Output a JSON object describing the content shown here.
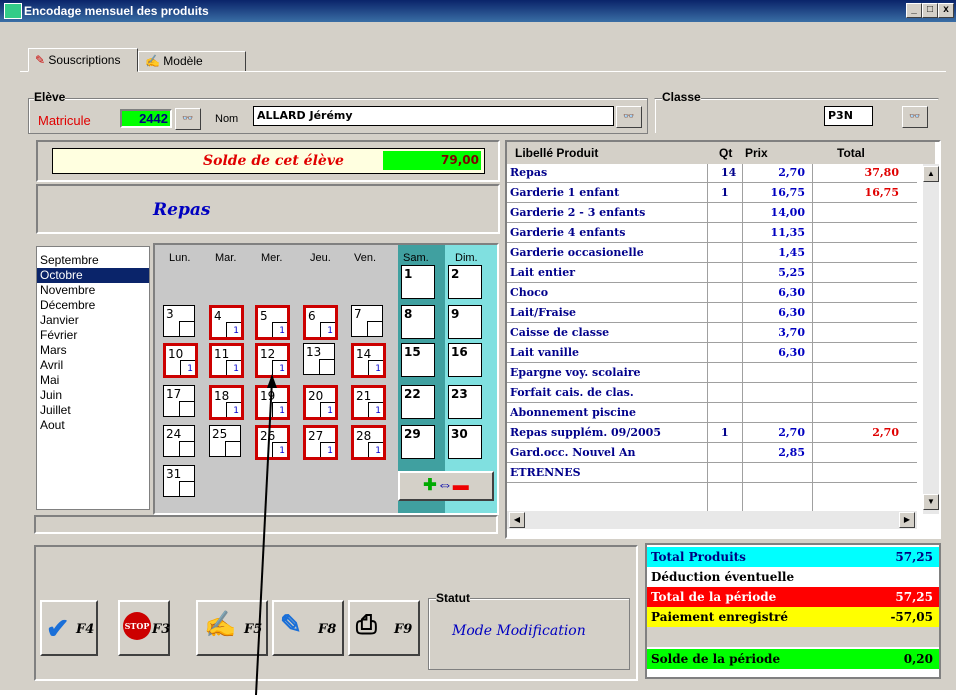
{
  "window": {
    "title": "Encodage mensuel des produits"
  },
  "tabs": [
    {
      "label": "Souscriptions"
    },
    {
      "label": "Modèle"
    }
  ],
  "eleve": {
    "group_label": "Elève",
    "matricule_label": "Matricule",
    "matricule_value": "2442",
    "nom_label": "Nom",
    "nom_value": "ALLARD Jérémy"
  },
  "classe": {
    "group_label": "Classe",
    "value": "P3N"
  },
  "solde": {
    "label": "Solde de cet élève",
    "value": "79,00"
  },
  "product_title": "Repas",
  "months": [
    "Septembre",
    "Octobre",
    "Novembre",
    "Décembre",
    "Janvier",
    "Février",
    "Mars",
    "Avril",
    "Mai",
    "Juin",
    "Juillet",
    "Aout"
  ],
  "selected_month": "Octobre",
  "weekdays": [
    "Lun.",
    "Mar.",
    "Mer.",
    "Jeu.",
    "Ven.",
    "Sam.",
    "Dim."
  ],
  "calendar": [
    {
      "day": "1",
      "q": ""
    },
    {
      "day": "2",
      "q": ""
    },
    {
      "day": "3",
      "q": ""
    },
    {
      "day": "4",
      "q": "1"
    },
    {
      "day": "5",
      "q": "1"
    },
    {
      "day": "6",
      "q": "1"
    },
    {
      "day": "7",
      "q": ""
    },
    {
      "day": "8",
      "q": ""
    },
    {
      "day": "9",
      "q": ""
    },
    {
      "day": "10",
      "q": "1"
    },
    {
      "day": "11",
      "q": "1"
    },
    {
      "day": "12",
      "q": "1"
    },
    {
      "day": "13",
      "q": ""
    },
    {
      "day": "14",
      "q": "1"
    },
    {
      "day": "15",
      "q": ""
    },
    {
      "day": "16",
      "q": ""
    },
    {
      "day": "17",
      "q": ""
    },
    {
      "day": "18",
      "q": "1"
    },
    {
      "day": "19",
      "q": "1"
    },
    {
      "day": "20",
      "q": "1"
    },
    {
      "day": "21",
      "q": "1"
    },
    {
      "day": "22",
      "q": ""
    },
    {
      "day": "23",
      "q": ""
    },
    {
      "day": "24",
      "q": ""
    },
    {
      "day": "25",
      "q": ""
    },
    {
      "day": "26",
      "q": "1"
    },
    {
      "day": "27",
      "q": "1"
    },
    {
      "day": "28",
      "q": "1"
    },
    {
      "day": "29",
      "q": ""
    },
    {
      "day": "30",
      "q": ""
    },
    {
      "day": "31",
      "q": ""
    }
  ],
  "grid": {
    "headers": {
      "libelle": "Libellé Produit",
      "qt": "Qt",
      "prix": "Prix",
      "total": "Total"
    },
    "rows": [
      {
        "libelle": "Repas",
        "qt": "14",
        "prix": "2,70",
        "total": "37,80"
      },
      {
        "libelle": "Garderie 1 enfant",
        "qt": "1",
        "prix": "16,75",
        "total": "16,75"
      },
      {
        "libelle": "Garderie 2 - 3 enfants",
        "qt": "",
        "prix": "14,00",
        "total": ""
      },
      {
        "libelle": "Garderie 4 enfants",
        "qt": "",
        "prix": "11,35",
        "total": ""
      },
      {
        "libelle": "Garderie occasionelle",
        "qt": "",
        "prix": "1,45",
        "total": ""
      },
      {
        "libelle": "Lait entier",
        "qt": "",
        "prix": "5,25",
        "total": ""
      },
      {
        "libelle": "Choco",
        "qt": "",
        "prix": "6,30",
        "total": ""
      },
      {
        "libelle": "Lait/Fraise",
        "qt": "",
        "prix": "6,30",
        "total": ""
      },
      {
        "libelle": "Caisse de classe",
        "qt": "",
        "prix": "3,70",
        "total": ""
      },
      {
        "libelle": "Lait vanille",
        "qt": "",
        "prix": "6,30",
        "total": ""
      },
      {
        "libelle": "Epargne voy. scolaire",
        "qt": "",
        "prix": "",
        "total": ""
      },
      {
        "libelle": "Forfait cais. de clas.",
        "qt": "",
        "prix": "",
        "total": ""
      },
      {
        "libelle": "Abonnement piscine",
        "qt": "",
        "prix": "",
        "total": ""
      },
      {
        "libelle": "Repas supplém. 09/2005",
        "qt": "1",
        "prix": "2,70",
        "total": "2,70"
      },
      {
        "libelle": "Gard.occ. Nouvel An",
        "qt": "",
        "prix": "2,85",
        "total": ""
      },
      {
        "libelle": "ETRENNES",
        "qt": "",
        "prix": "",
        "total": ""
      }
    ]
  },
  "summary": [
    {
      "label": "Total Produits",
      "value": "57,25",
      "bg": "#00ffff",
      "color": "#000080"
    },
    {
      "label": "Déduction éventuelle",
      "value": "",
      "bg": "#ffffff",
      "color": "#000000"
    },
    {
      "label": "Total de la période",
      "value": "57,25",
      "bg": "#ff0000",
      "color": "#ffffff"
    },
    {
      "label": "Paiement enregistré",
      "value": "-57,05",
      "bg": "#ffff00",
      "color": "#000000"
    },
    {
      "label": "",
      "value": "",
      "bg": "#d4d0c8",
      "color": "#000000"
    },
    {
      "label": "Solde de la période",
      "value": "0,20",
      "bg": "#00ff00",
      "color": "#000000"
    }
  ],
  "buttons": {
    "f4": "F4",
    "f3": "F3",
    "f5": "F5",
    "f8": "F8",
    "f9": "F9",
    "stop": "STOP"
  },
  "statut": {
    "group_label": "Statut",
    "value": "Mode Modification"
  },
  "colors": {
    "accent": "#0a246a",
    "selected_day_border": "#cc0000",
    "saturday": "#40a0a0",
    "sunday": "#80e0e0"
  }
}
